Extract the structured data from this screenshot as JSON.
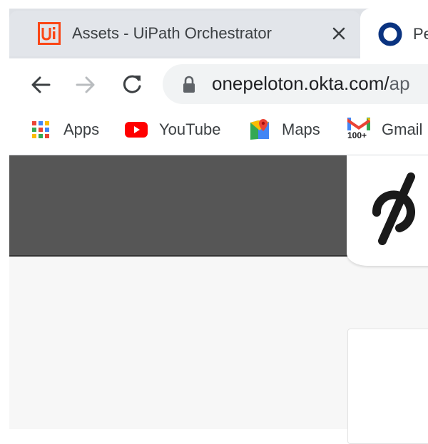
{
  "tabs": [
    {
      "title": "Assets - UiPath Orchestrator",
      "favicon": "uipath-logo-icon",
      "active": false
    },
    {
      "title": "Pe",
      "favicon": "peloton-circle-icon",
      "active": true
    }
  ],
  "toolbar": {
    "back": "back-arrow-icon",
    "forward": "forward-arrow-icon",
    "reload": "reload-icon",
    "url": "onepeloton.okta.com/",
    "url_tail": "ap"
  },
  "bookmarks": [
    {
      "label": "Apps",
      "icon": "apps-grid-icon"
    },
    {
      "label": "YouTube",
      "icon": "youtube-icon"
    },
    {
      "label": "Maps",
      "icon": "maps-icon"
    },
    {
      "label": "Gmail",
      "icon": "gmail-icon",
      "badge": "100+"
    }
  ],
  "colors": {
    "uipath": "#fa4616",
    "youtube": "#ff0000",
    "header": "#565656",
    "peloton_tab_ring": "#0a3380"
  }
}
